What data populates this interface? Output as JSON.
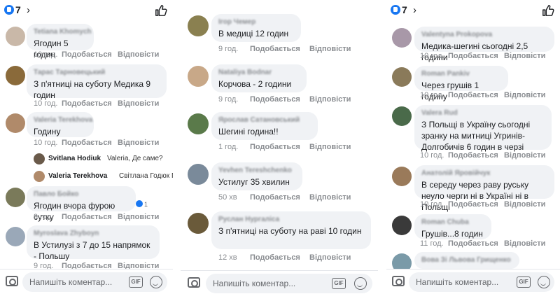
{
  "panels": [
    {
      "likes": "7",
      "comments": [
        {
          "author": "Tetiana Khomych",
          "text": "Ягодин 5 годин",
          "time": "10 год.",
          "like": "Подобається",
          "reply": "Відповісти"
        },
        {
          "author": "Тарас Тарновецький",
          "text": "З п'ятниці на суботу Медика 9 годин",
          "time": "10 год.",
          "like": "Подобається",
          "reply": "Відповісти"
        },
        {
          "author": "Valeria Terekhova",
          "text": "Годину",
          "time": "10 год.",
          "like": "Подобається",
          "reply": "Відповісти"
        },
        {
          "author": "Павло Бойко",
          "text": "Ягодин вчора фурою сутку",
          "time": "9 год.",
          "like": "Подобається",
          "reply": "Відповісти",
          "reactions": "1"
        },
        {
          "author": "Myroslava Zhyboyn",
          "text": "В Устилузі з 7 до 15 напрямок - Польшу",
          "time": "9 год.",
          "like": "Подобається",
          "reply": "Відповісти"
        }
      ],
      "replies": [
        {
          "name": "Svitlana Hodiuk",
          "text": "Valeria, Де саме?"
        },
        {
          "name": "Valeria Terekhova",
          "text": "Світлана Годюк Гр..."
        }
      ]
    },
    {
      "comments": [
        {
          "author": "Ігор Чемер",
          "text": "В медиці 12 годин",
          "time": "9 год.",
          "like": "Подобається",
          "reply": "Відповісти"
        },
        {
          "author": "Nataliya Bodnar",
          "text": "Корчова - 2 години",
          "time": "9 год.",
          "like": "Подобається",
          "reply": "Відповісти"
        },
        {
          "author": "Ярослав Сатановський",
          "text": "Шегині година!!",
          "time": "1 год.",
          "like": "Подобається",
          "reply": "Відповісти"
        },
        {
          "author": "Yevhen Tereshchenko",
          "text": "Устилуг 35 хвилин",
          "time": "50 хв",
          "like": "Подобається",
          "reply": "Відповісти"
        },
        {
          "author": "Руслан Нургаліса",
          "text": "З п'ятниці на суботу на раві 10 годин",
          "time": "12 хв",
          "like": "Подобається",
          "reply": "Відповісти"
        }
      ]
    },
    {
      "likes": "7",
      "comments": [
        {
          "author": "Valentyna Prokopova",
          "text": "Медика-шегині сьогодні 2,5 години",
          "time": "10 год.",
          "like": "Подобається",
          "reply": "Відповісти"
        },
        {
          "author": "Roman Pankiv",
          "text": "Через грушів 1 годину",
          "time": "10 год.",
          "like": "Подобається",
          "reply": "Відповісти"
        },
        {
          "author": "Valera Rud",
          "text": "З Польщі в Україну сьогодні зранку на митниці Угринів-Долгобичів 6 годин в черзі",
          "time": "10 год.",
          "like": "Подобається",
          "reply": "Відповісти"
        },
        {
          "author": "Анатолій Яровійчук",
          "text": "В середу через раву руську неуло черги ні в Україні ні в Польщі",
          "time": "10 год.",
          "like": "Подобається",
          "reply": "Відповісти"
        },
        {
          "author": "Roman Chuba",
          "text": "Грушів...8 годин",
          "time": "11 год.",
          "like": "Подобається",
          "reply": "Відповісти"
        },
        {
          "author": "Вова Зі Львова Грищенко",
          "text": "",
          "time": "",
          "like": "",
          "reply": ""
        }
      ]
    }
  ],
  "footer": {
    "placeholder": "Напишіть коментар...",
    "gif": "GIF"
  },
  "colors": {
    "bubble": "#f0f2f5",
    "meta": "#8a8d91",
    "accent": "#1877f2"
  }
}
